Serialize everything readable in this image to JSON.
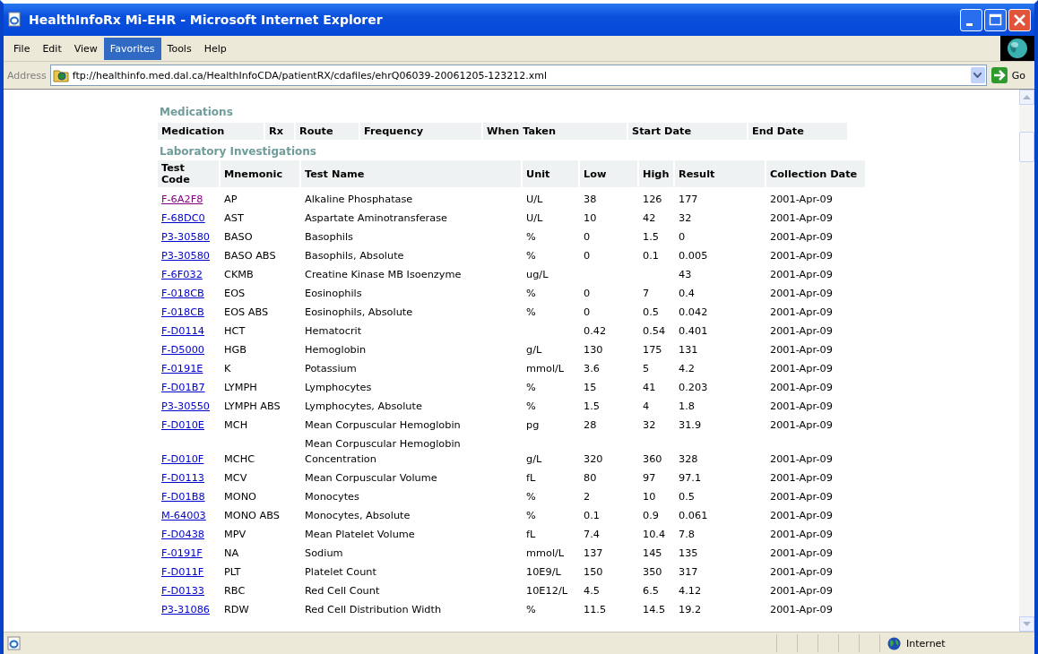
{
  "window": {
    "title": "HealthInfoRx Mi-EHR - Microsoft Internet Explorer"
  },
  "menu": [
    {
      "label": "File",
      "selected": false
    },
    {
      "label": "Edit",
      "selected": false
    },
    {
      "label": "View",
      "selected": false
    },
    {
      "label": "Favorites",
      "selected": true
    },
    {
      "label": "Tools",
      "selected": false
    },
    {
      "label": "Help",
      "selected": false
    }
  ],
  "address_bar": {
    "label": "Address",
    "value": "ftp://healthinfo.med.dal.ca/HealthInfoCDA/patientRX/cdafiles/ehrQ06039-20061205-123212.xml",
    "go_label": "Go"
  },
  "medications": {
    "title": "Medications",
    "columns": [
      "Medication",
      "Rx",
      "Route",
      "Frequency",
      "When Taken",
      "Start Date",
      "End Date"
    ]
  },
  "laboratory": {
    "title": "Laboratory Investigations",
    "columns": [
      "Test Code",
      "Mnemonic",
      "Test Name",
      "Unit",
      "Low",
      "High",
      "Result",
      "Collection Date"
    ],
    "rows": [
      {
        "test_code": "F-6A2F8",
        "visited": true,
        "mnemonic": "AP",
        "test_name": "Alkaline Phosphatase",
        "unit": "U/L",
        "low": "38",
        "high": "126",
        "result": "177",
        "collection_date": "2001-Apr-09"
      },
      {
        "test_code": "F-68DC0",
        "visited": false,
        "mnemonic": "AST",
        "test_name": "Aspartate Aminotransferase",
        "unit": "U/L",
        "low": "10",
        "high": "42",
        "result": "32",
        "collection_date": "2001-Apr-09"
      },
      {
        "test_code": "P3-30580",
        "visited": false,
        "mnemonic": "BASO",
        "test_name": "Basophils",
        "unit": "%",
        "low": "0",
        "high": "1.5",
        "result": "0",
        "collection_date": "2001-Apr-09"
      },
      {
        "test_code": "P3-30580",
        "visited": false,
        "mnemonic": "BASO ABS",
        "test_name": "Basophils, Absolute",
        "unit": "%",
        "low": "0",
        "high": "0.1",
        "result": "0.005",
        "collection_date": "2001-Apr-09"
      },
      {
        "test_code": "F-6F032",
        "visited": false,
        "mnemonic": "CKMB",
        "test_name": "Creatine Kinase MB Isoenzyme",
        "unit": "ug/L",
        "result": "43",
        "collection_date": "2001-Apr-09"
      },
      {
        "test_code": "F-018CB",
        "visited": false,
        "mnemonic": "EOS",
        "test_name": "Eosinophils",
        "unit": "%",
        "low": "0",
        "high": "7",
        "result": "0.4",
        "collection_date": "2001-Apr-09"
      },
      {
        "test_code": "F-018CB",
        "visited": false,
        "mnemonic": "EOS ABS",
        "test_name": "Eosinophils, Absolute",
        "unit": "%",
        "low": "0",
        "high": "0.5",
        "result": "0.042",
        "collection_date": "2001-Apr-09"
      },
      {
        "test_code": "F-D0114",
        "visited": false,
        "mnemonic": "HCT",
        "test_name": "Hematocrit",
        "low": "0.42",
        "high": "0.54",
        "result": "0.401",
        "collection_date": "2001-Apr-09"
      },
      {
        "test_code": "F-D5000",
        "visited": false,
        "mnemonic": "HGB",
        "test_name": "Hemoglobin",
        "unit": "g/L",
        "low": "130",
        "high": "175",
        "result": "131",
        "collection_date": "2001-Apr-09"
      },
      {
        "test_code": "F-0191E",
        "visited": false,
        "mnemonic": "K",
        "test_name": "Potassium",
        "unit": "mmol/L",
        "low": "3.6",
        "high": "5",
        "result": "4.2",
        "collection_date": "2001-Apr-09"
      },
      {
        "test_code": "F-D01B7",
        "visited": false,
        "mnemonic": "LYMPH",
        "test_name": "Lymphocytes",
        "unit": "%",
        "low": "15",
        "high": "41",
        "result": "0.203",
        "collection_date": "2001-Apr-09"
      },
      {
        "test_code": "P3-30550",
        "visited": false,
        "mnemonic": "LYMPH ABS",
        "test_name": "Lymphocytes, Absolute",
        "unit": "%",
        "low": "1.5",
        "high": "4",
        "result": "1.8",
        "collection_date": "2001-Apr-09"
      },
      {
        "test_code": "F-D010E",
        "visited": false,
        "mnemonic": "MCH",
        "test_name": "Mean Corpuscular Hemoglobin",
        "unit": "pg",
        "low": "28",
        "high": "32",
        "result": "31.9",
        "collection_date": "2001-Apr-09"
      },
      {
        "test_code": "F-D010F",
        "visited": false,
        "mnemonic": "MCHC",
        "test_name": "Mean Corpuscular Hemoglobin Concentration",
        "unit": "g/L",
        "low": "320",
        "high": "360",
        "result": "328",
        "collection_date": "2001-Apr-09"
      },
      {
        "test_code": "F-D0113",
        "visited": false,
        "mnemonic": "MCV",
        "test_name": "Mean Corpuscular Volume",
        "unit": "fL",
        "low": "80",
        "high": "97",
        "result": "97.1",
        "collection_date": "2001-Apr-09"
      },
      {
        "test_code": "F-D01B8",
        "visited": false,
        "mnemonic": "MONO",
        "test_name": "Monocytes",
        "unit": "%",
        "low": "2",
        "high": "10",
        "result": "0.5",
        "collection_date": "2001-Apr-09"
      },
      {
        "test_code": "M-64003",
        "visited": false,
        "mnemonic": "MONO ABS",
        "test_name": "Monocytes, Absolute",
        "unit": "%",
        "low": "0.1",
        "high": "0.9",
        "result": "0.061",
        "collection_date": "2001-Apr-09"
      },
      {
        "test_code": "F-D0438",
        "visited": false,
        "mnemonic": "MPV",
        "test_name": "Mean Platelet Volume",
        "unit": "fL",
        "low": "7.4",
        "high": "10.4",
        "result": "7.8",
        "collection_date": "2001-Apr-09"
      },
      {
        "test_code": "F-0191F",
        "visited": false,
        "mnemonic": "NA",
        "test_name": "Sodium",
        "unit": "mmol/L",
        "low": "137",
        "high": "145",
        "result": "135",
        "collection_date": "2001-Apr-09"
      },
      {
        "test_code": "F-D011F",
        "visited": false,
        "mnemonic": "PLT",
        "test_name": "Platelet Count",
        "unit": "10E9/L",
        "low": "150",
        "high": "350",
        "result": "317",
        "collection_date": "2001-Apr-09"
      },
      {
        "test_code": "F-D0133",
        "visited": false,
        "mnemonic": "RBC",
        "test_name": "Red Cell Count",
        "unit": "10E12/L",
        "low": "4.5",
        "high": "6.5",
        "result": "4.12",
        "collection_date": "2001-Apr-09"
      },
      {
        "test_code": "P3-31086",
        "visited": false,
        "mnemonic": "RDW",
        "test_name": "Red Cell Distribution Width",
        "unit": "%",
        "low": "11.5",
        "high": "14.5",
        "result": "19.2",
        "collection_date": "2001-Apr-09"
      }
    ]
  },
  "status_bar": {
    "zone": "Internet"
  }
}
